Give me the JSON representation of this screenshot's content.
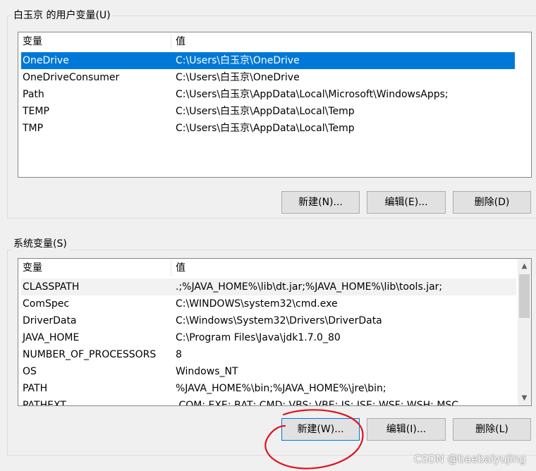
{
  "user_group": {
    "title": "白玉京 的用户变量(U)",
    "col_name": "变量",
    "col_value": "值",
    "rows": [
      {
        "name": "OneDrive",
        "value": "C:\\Users\\白玉京\\OneDrive"
      },
      {
        "name": "OneDriveConsumer",
        "value": "C:\\Users\\白玉京\\OneDrive"
      },
      {
        "name": "Path",
        "value": "C:\\Users\\白玉京\\AppData\\Local\\Microsoft\\WindowsApps;"
      },
      {
        "name": "TEMP",
        "value": "C:\\Users\\白玉京\\AppData\\Local\\Temp"
      },
      {
        "name": "TMP",
        "value": "C:\\Users\\白玉京\\AppData\\Local\\Temp"
      }
    ],
    "selected_row": "OneDrive",
    "buttons": {
      "new": "新建(N)...",
      "edit": "编辑(E)...",
      "delete": "删除(D)"
    }
  },
  "system_group": {
    "title": "系统变量(S)",
    "col_name": "变量",
    "col_value": "值",
    "rows": [
      {
        "name": "CLASSPATH",
        "value": ".;%JAVA_HOME%\\lib\\dt.jar;%JAVA_HOME%\\lib\\tools.jar;"
      },
      {
        "name": "ComSpec",
        "value": "C:\\WINDOWS\\system32\\cmd.exe"
      },
      {
        "name": "DriverData",
        "value": "C:\\Windows\\System32\\Drivers\\DriverData"
      },
      {
        "name": "JAVA_HOME",
        "value": "C:\\Program Files\\Java\\jdk1.7.0_80"
      },
      {
        "name": "NUMBER_OF_PROCESSORS",
        "value": "8"
      },
      {
        "name": "OS",
        "value": "Windows_NT"
      },
      {
        "name": "PATH",
        "value": "%JAVA_HOME%\\bin;%JAVA_HOME%\\jre\\bin;"
      },
      {
        "name": "PATHEXT",
        "value": ".COM;.EXE;.BAT;.CMD;.VBS;.VBE;.JS;.JSE;.WSF;.WSH;.MSC"
      }
    ],
    "highlighted_row": "CLASSPATH",
    "buttons": {
      "new": "新建(W)...",
      "edit": "编辑(I)...",
      "delete": "删除(L)"
    }
  },
  "watermark": "CSDN @baebaiyujing",
  "colors": {
    "selection": "#0078d7",
    "annotation_circle": "#e0141e"
  },
  "icons": {
    "scroll_up": "chevron-up-icon",
    "scroll_down": "chevron-down-icon"
  }
}
